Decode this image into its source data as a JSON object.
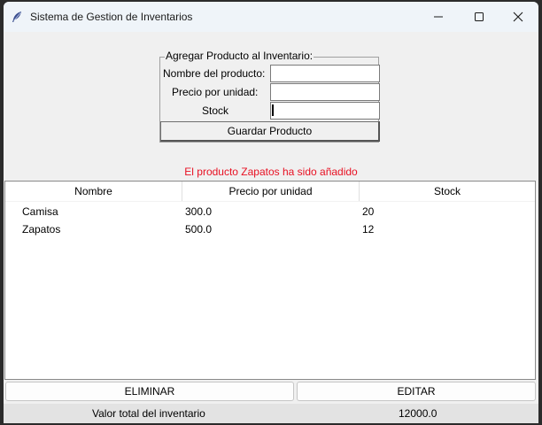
{
  "window": {
    "title": "Sistema de Gestion de Inventarios",
    "icon": "feather-icon"
  },
  "form": {
    "legend": "Agregar Producto al Inventario:",
    "name_label": "Nombre del producto:",
    "price_label": "Precio por unidad:",
    "stock_label": "Stock",
    "name_value": "",
    "price_value": "",
    "stock_value": "",
    "save_label": "Guardar Producto"
  },
  "status": {
    "message": "El producto Zapatos ha sido añadido",
    "color": "#e81123"
  },
  "table": {
    "columns": [
      "Nombre",
      "Precio por unidad",
      "Stock"
    ],
    "rows": [
      [
        "Camisa",
        "300.0",
        "20"
      ],
      [
        "Zapatos",
        "500.0",
        "12"
      ]
    ]
  },
  "actions": {
    "delete_label": "ELIMINAR",
    "edit_label": "EDITAR"
  },
  "footer": {
    "total_label": "Valor total del inventario",
    "total_value": "12000.0"
  }
}
